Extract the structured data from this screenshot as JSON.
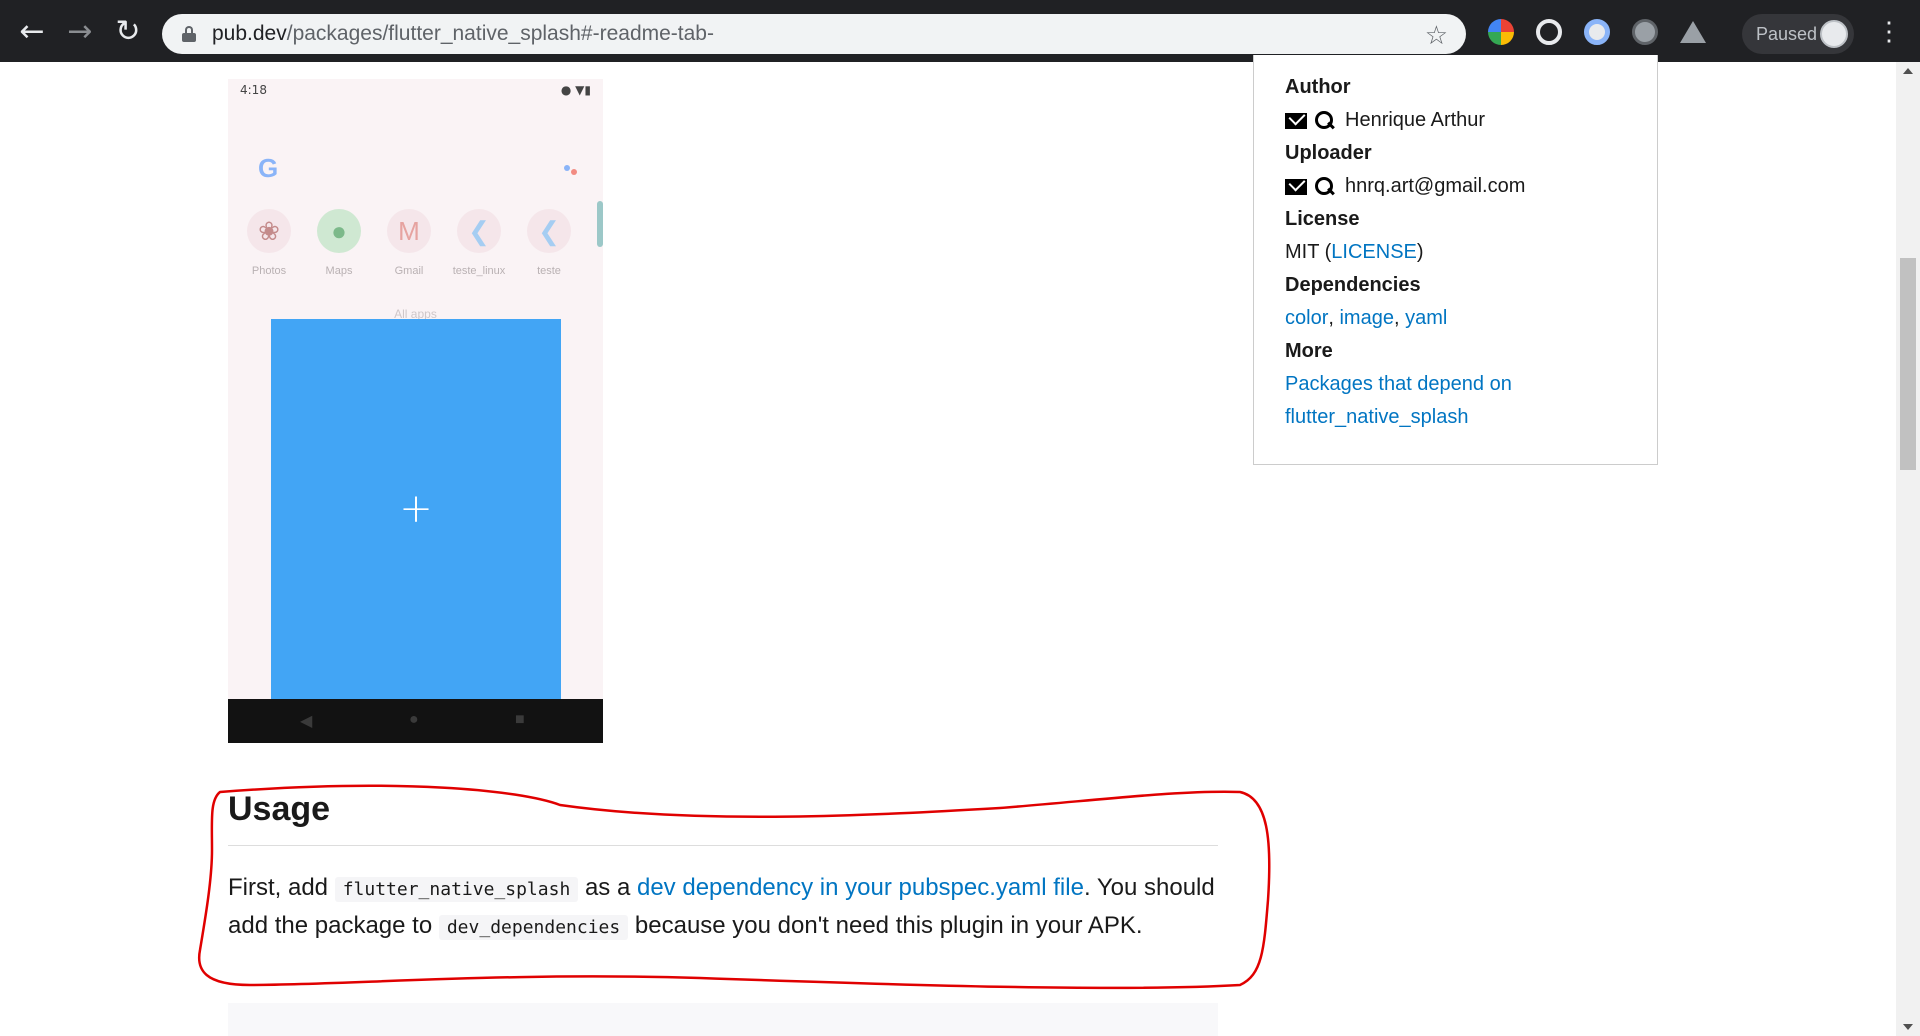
{
  "browser": {
    "url_host": "pub.dev",
    "url_path": "/packages/flutter_native_splash#-readme-tab-",
    "profile_status": "Paused",
    "icons": [
      "back-arrow-icon",
      "forward-arrow-icon",
      "reload-icon",
      "lock-icon",
      "star-icon",
      "kebab-menu-icon"
    ]
  },
  "phone_screenshot": {
    "time": "4:18",
    "apps": [
      "Photos",
      "Maps",
      "Gmail",
      "teste_linux",
      "teste"
    ],
    "all_apps_label": "All apps",
    "fab_symbol": "+",
    "card_color": "#42a5f5"
  },
  "sidebar": {
    "author_heading": "Author",
    "author_name": "Henrique Arthur",
    "uploader_heading": "Uploader",
    "uploader_email": "hnrq.art@gmail.com",
    "license_heading": "License",
    "license_prefix": "MIT (",
    "license_link": "LICENSE",
    "license_suffix": ")",
    "dependencies_heading": "Dependencies",
    "dependencies": [
      "color",
      "image",
      "yaml"
    ],
    "more_heading": "More",
    "more_link_line1": "Packages that depend on",
    "more_link_line2": "flutter_native_splash"
  },
  "readme": {
    "usage_heading": "Usage",
    "p_part1": "First, add ",
    "p_code1": "flutter_native_splash",
    "p_part2": " as a ",
    "p_link": "dev dependency in your pubspec.yaml file",
    "p_part3": ". You should add the package to ",
    "p_code2": "dev_dependencies",
    "p_part4": " because you don't need this plugin in your APK."
  },
  "colors": {
    "link": "#0175c2",
    "annotation_red": "#e00000",
    "chrome_dark": "#202124"
  }
}
